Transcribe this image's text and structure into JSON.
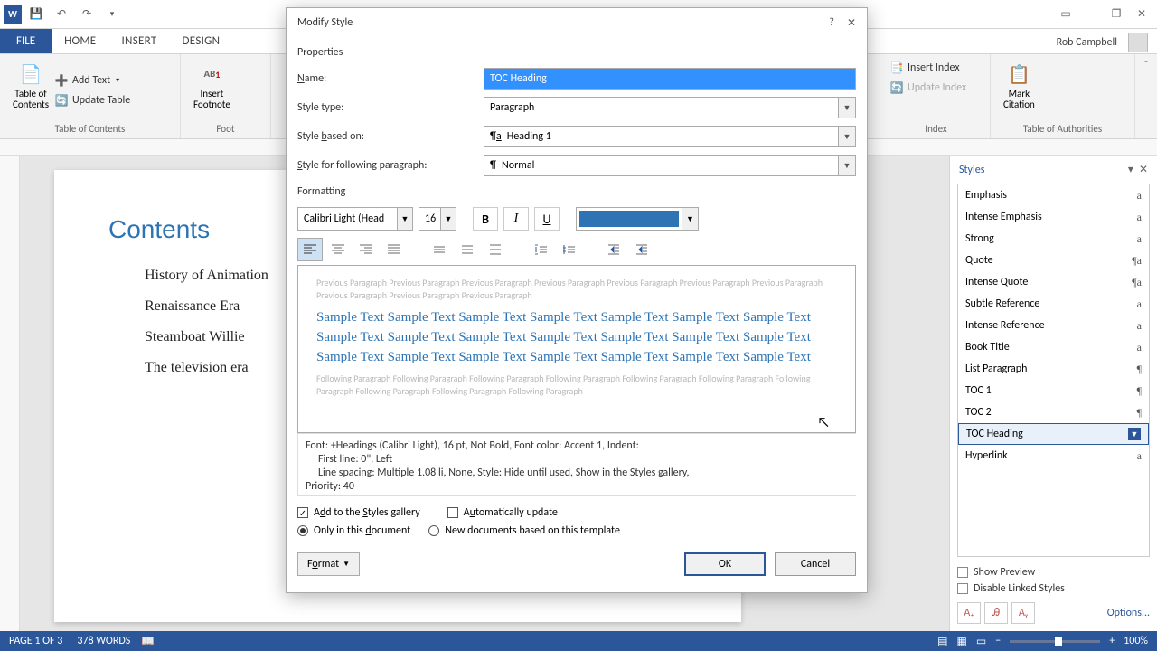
{
  "titlebar": {
    "user": "Rob Campbell"
  },
  "file_tab": "FILE",
  "tabs": [
    "HOME",
    "INSERT",
    "DESIGN"
  ],
  "ribbon": {
    "toc": {
      "big": "Table of\nContents",
      "add": "Add Text",
      "update": "Update Table",
      "group": "Table of Contents"
    },
    "footnote": {
      "big": "Insert\nFootnote",
      "ab": "AB",
      "group": "Foot"
    },
    "index": {
      "insert": "Insert Index",
      "update": "Update Index",
      "group": "Index"
    },
    "citation": {
      "big": "Mark\nCitation",
      "group": "Table of Authorities"
    }
  },
  "document": {
    "title": "Contents",
    "toc_items": [
      "History of Animation",
      "Renaissance Era",
      "Steamboat Willie",
      "The television era"
    ]
  },
  "styles_pane": {
    "title": "Styles",
    "items": [
      {
        "name": "Emphasis",
        "sym": "a"
      },
      {
        "name": "Intense Emphasis",
        "sym": "a"
      },
      {
        "name": "Strong",
        "sym": "a"
      },
      {
        "name": "Quote",
        "sym": "¶a"
      },
      {
        "name": "Intense Quote",
        "sym": "¶a"
      },
      {
        "name": "Subtle Reference",
        "sym": "a"
      },
      {
        "name": "Intense Reference",
        "sym": "a"
      },
      {
        "name": "Book Title",
        "sym": "a"
      },
      {
        "name": "List Paragraph",
        "sym": "¶"
      },
      {
        "name": "TOC 1",
        "sym": "¶"
      },
      {
        "name": "TOC 2",
        "sym": "¶"
      },
      {
        "name": "TOC Heading",
        "sym": "",
        "selected": true
      },
      {
        "name": "Hyperlink",
        "sym": "a"
      }
    ],
    "show_preview": "Show Preview",
    "disable_linked": "Disable Linked Styles",
    "options": "Options..."
  },
  "dialog": {
    "title": "Modify Style",
    "properties": "Properties",
    "name_label": "Name:",
    "name_value": "TOC Heading",
    "type_label": "Style type:",
    "type_value": "Paragraph",
    "based_label": "Style based on:",
    "based_value": "Heading 1",
    "following_label": "Style for following paragraph:",
    "following_value": "Normal",
    "formatting": "Formatting",
    "font": "Calibri Light (Head",
    "size": "16",
    "color": "#2e74b5",
    "preview_prev": "Previous Paragraph Previous Paragraph Previous Paragraph Previous Paragraph Previous Paragraph Previous Paragraph Previous Paragraph Previous Paragraph Previous Paragraph Previous Paragraph",
    "preview_sample": "Sample Text Sample Text Sample Text Sample Text Sample Text Sample Text Sample Text Sample Text Sample Text Sample Text Sample Text Sample Text Sample Text Sample Text Sample Text Sample Text Sample Text Sample Text Sample Text Sample Text Sample Text",
    "preview_next": "Following Paragraph Following Paragraph Following Paragraph Following Paragraph Following Paragraph Following Paragraph Following Paragraph Following Paragraph Following Paragraph Following Paragraph",
    "desc_line1": "Font: +Headings (Calibri Light), 16 pt, Not Bold, Font color: Accent 1, Indent:",
    "desc_line2": "First line:  0\", Left",
    "desc_line3": "Line spacing:  Multiple 1.08 li, None, Style: Hide until used, Show in the Styles gallery,",
    "desc_line4": "Priority: 40",
    "add_gallery": "Add to the Styles gallery",
    "auto_update": "Automatically update",
    "only_doc": "Only in this document",
    "new_docs": "New documents based on this template",
    "format_btn": "Format",
    "ok": "OK",
    "cancel": "Cancel"
  },
  "statusbar": {
    "page": "PAGE 1 OF 3",
    "words": "378 WORDS",
    "zoom": "100%"
  }
}
